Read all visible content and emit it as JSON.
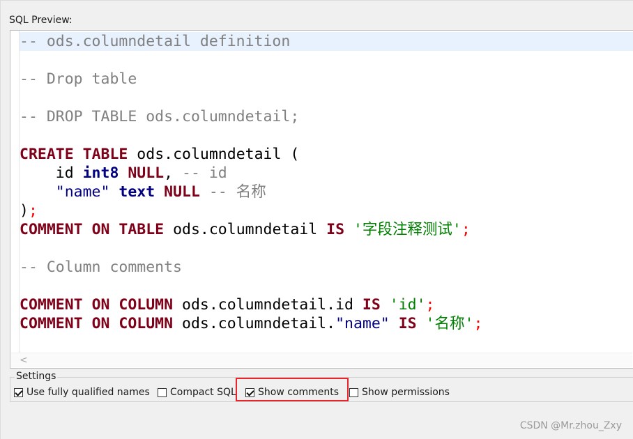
{
  "preview": {
    "label": "SQL Preview:",
    "code_lines": [
      [
        {
          "t": "-- ods.columndetail definition",
          "c": "comment"
        }
      ],
      [],
      [
        {
          "t": "-- Drop table",
          "c": "comment"
        }
      ],
      [],
      [
        {
          "t": "-- DROP TABLE ods.columndetail;",
          "c": "comment"
        }
      ],
      [],
      [
        {
          "t": "CREATE",
          "c": "kw"
        },
        {
          "t": " "
        },
        {
          "t": "TABLE",
          "c": "kw"
        },
        {
          "t": " ods.columndetail ("
        }
      ],
      [
        {
          "t": "    id "
        },
        {
          "t": "int8",
          "c": "type"
        },
        {
          "t": " "
        },
        {
          "t": "NULL",
          "c": "kw"
        },
        {
          "t": ", "
        },
        {
          "t": "-- id",
          "c": "comment"
        }
      ],
      [
        {
          "t": "    "
        },
        {
          "t": "\"name\"",
          "c": "quoted"
        },
        {
          "t": " "
        },
        {
          "t": "text",
          "c": "type"
        },
        {
          "t": " "
        },
        {
          "t": "NULL",
          "c": "kw"
        },
        {
          "t": " "
        },
        {
          "t": "-- 名称",
          "c": "comment"
        }
      ],
      [
        {
          "t": ")"
        },
        {
          "t": ";",
          "c": "semi"
        }
      ],
      [
        {
          "t": "COMMENT",
          "c": "kw"
        },
        {
          "t": " "
        },
        {
          "t": "ON",
          "c": "kw"
        },
        {
          "t": " "
        },
        {
          "t": "TABLE",
          "c": "kw"
        },
        {
          "t": " ods.columndetail "
        },
        {
          "t": "IS",
          "c": "kw"
        },
        {
          "t": " "
        },
        {
          "t": "'字段注释测试'",
          "c": "str"
        },
        {
          "t": ";",
          "c": "semi"
        }
      ],
      [],
      [
        {
          "t": "-- Column comments",
          "c": "comment"
        }
      ],
      [],
      [
        {
          "t": "COMMENT",
          "c": "kw"
        },
        {
          "t": " "
        },
        {
          "t": "ON",
          "c": "kw"
        },
        {
          "t": " "
        },
        {
          "t": "COLUMN",
          "c": "kw"
        },
        {
          "t": " ods.columndetail.id "
        },
        {
          "t": "IS",
          "c": "kw"
        },
        {
          "t": " "
        },
        {
          "t": "'id'",
          "c": "str"
        },
        {
          "t": ";",
          "c": "semi"
        }
      ],
      [
        {
          "t": "COMMENT",
          "c": "kw"
        },
        {
          "t": " "
        },
        {
          "t": "ON",
          "c": "kw"
        },
        {
          "t": " "
        },
        {
          "t": "COLUMN",
          "c": "kw"
        },
        {
          "t": " ods.columndetail."
        },
        {
          "t": "\"name\"",
          "c": "quoted"
        },
        {
          "t": " "
        },
        {
          "t": "IS",
          "c": "kw"
        },
        {
          "t": " "
        },
        {
          "t": "'名称'",
          "c": "str"
        },
        {
          "t": ";",
          "c": "semi"
        }
      ]
    ],
    "scroll_left_glyph": "<"
  },
  "settings": {
    "title": "Settings",
    "options": [
      {
        "label": "Use fully qualified names",
        "checked": true
      },
      {
        "label": "Compact SQL",
        "checked": false
      },
      {
        "label": "Show comments",
        "checked": true
      },
      {
        "label": "Show permissions",
        "checked": false
      }
    ]
  },
  "watermark": "CSDN @Mr.zhou_Zxy",
  "colors": {
    "keyword": "#7f0019",
    "comment": "#808080",
    "string": "#008000",
    "type": "#000080",
    "highlight_box": "#e8252a",
    "current_line": "#e8f2fe"
  }
}
